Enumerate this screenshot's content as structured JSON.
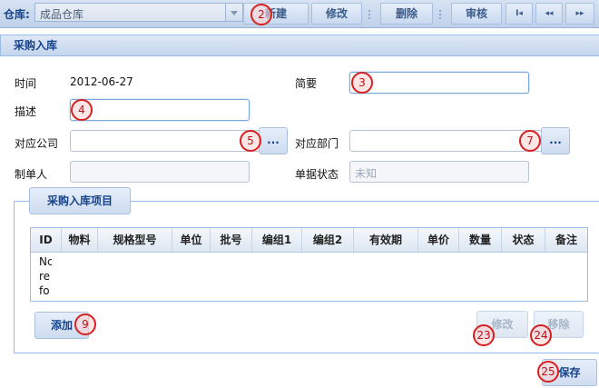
{
  "toolbar": {
    "warehouse_label": "仓库:",
    "warehouse_value": "成品仓库",
    "new_label": "新建",
    "edit_label": "修改",
    "delete_label": "删除",
    "audit_label": "审核",
    "nav_first": "I◂",
    "nav_prev": "◂◂",
    "nav_next": "▸▸"
  },
  "panel": {
    "title": "采购入库"
  },
  "form": {
    "time_label": "时间",
    "time_value": "2012-06-27",
    "summary_label": "简要",
    "desc_label": "描述",
    "company_label": "对应公司",
    "company_btn": "...",
    "department_label": "对应部门",
    "department_btn": "...",
    "creator_label": "制单人",
    "doc_status_label": "单据状态",
    "doc_status_value": "未知"
  },
  "items": {
    "legend": "采购入库项目",
    "columns": [
      "ID",
      "物料",
      "规格型号",
      "单位",
      "批号",
      "编组1",
      "编组2",
      "有效期",
      "单价",
      "数量",
      "状态",
      "备注"
    ],
    "body_lines": [
      "Nc",
      "re",
      "fo"
    ],
    "add_label": "添加",
    "edit_label": "修改",
    "remove_label": "移除"
  },
  "save_label": "保存",
  "markers": [
    "2",
    "3",
    "4",
    "5",
    "7",
    "9",
    "23",
    "24",
    "25"
  ],
  "colors": {
    "accent": "#15428b",
    "marker": "#d62020",
    "border": "#99bbe8"
  }
}
